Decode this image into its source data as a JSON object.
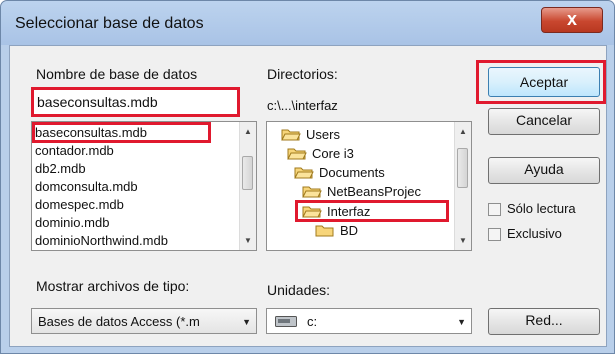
{
  "dialog": {
    "title": "Seleccionar base de datos",
    "close_glyph": "x"
  },
  "db_name": {
    "label": "Nombre de base de datos",
    "value": "baseconsultas.mdb",
    "files": [
      "baseconsultas.mdb",
      "contador.mdb",
      "db2.mdb",
      "domconsulta.mdb",
      "domespec.mdb",
      "dominio.mdb",
      "dominioNorthwind.mdb"
    ]
  },
  "directories": {
    "label": "Directorios:",
    "path": "c:\\...\\interfaz",
    "folders": [
      "Users",
      "Core i3",
      "Documents",
      "NetBeansProjec",
      "Interfaz",
      "BD"
    ]
  },
  "buttons": {
    "ok": "Aceptar",
    "cancel": "Cancelar",
    "help": "Ayuda",
    "network": "Red..."
  },
  "options": {
    "readonly": "Sólo lectura",
    "exclusive": "Exclusivo"
  },
  "file_type": {
    "label": "Mostrar archivos de tipo:",
    "value": "Bases de datos Access (*.m"
  },
  "drives": {
    "label": "Unidades:",
    "value": "c:"
  },
  "highlight_color": "#e0192e",
  "icons": [
    "close-icon",
    "folder-icon",
    "open-folder-icon",
    "drive-icon",
    "scroll-up-icon",
    "scroll-down-icon",
    "dropdown-arrow-icon"
  ]
}
